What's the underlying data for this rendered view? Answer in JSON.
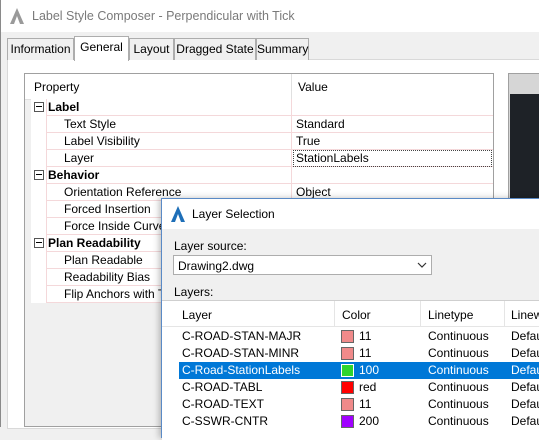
{
  "window": {
    "title": "Label Style Composer - Perpendicular with Tick"
  },
  "tabs": [
    {
      "label": "Information"
    },
    {
      "label": "General"
    },
    {
      "label": "Layout"
    },
    {
      "label": "Dragged State"
    },
    {
      "label": "Summary"
    }
  ],
  "grid": {
    "col_property": "Property",
    "col_value": "Value",
    "rows": [
      {
        "label": "Label",
        "value": ""
      },
      {
        "label": "Text Style",
        "value": "Standard"
      },
      {
        "label": "Label Visibility",
        "value": "True"
      },
      {
        "label": "Layer",
        "value": "StationLabels"
      },
      {
        "label": "Behavior",
        "value": ""
      },
      {
        "label": "Orientation Reference",
        "value": "Object"
      },
      {
        "label": "Forced Insertion",
        "value": ""
      },
      {
        "label": "Force Inside Curve",
        "value": ""
      },
      {
        "label": "Plan Readability",
        "value": ""
      },
      {
        "label": "Plan Readable",
        "value": ""
      },
      {
        "label": "Readability Bias",
        "value": ""
      },
      {
        "label": "Flip Anchors with Tex",
        "value": ""
      }
    ]
  },
  "dialog": {
    "title": "Layer Selection",
    "source_label": "Layer source:",
    "source_value": "Drawing2.dwg",
    "layers_label": "Layers:",
    "columns": {
      "layer": "Layer",
      "color": "Color",
      "linetype": "Linetype",
      "lineweight": "Linew"
    },
    "layers": [
      {
        "name": "C-ROAD-STAN-MAJR",
        "color": "11",
        "swatch": "#f08a8a",
        "linetype": "Continuous",
        "lineweight": "Defau"
      },
      {
        "name": "C-ROAD-STAN-MINR",
        "color": "11",
        "swatch": "#f08a8a",
        "linetype": "Continuous",
        "lineweight": "Defau"
      },
      {
        "name": "C-Road-StationLabels",
        "color": "100",
        "swatch": "#2ed42e",
        "linetype": "Continuous",
        "lineweight": "Defau"
      },
      {
        "name": "C-ROAD-TABL",
        "color": "red",
        "swatch": "#ff0000",
        "linetype": "Continuous",
        "lineweight": "Defau"
      },
      {
        "name": "C-ROAD-TEXT",
        "color": "11",
        "swatch": "#f08a8a",
        "linetype": "Continuous",
        "lineweight": "Defau"
      },
      {
        "name": "C-SSWR-CNTR",
        "color": "200",
        "swatch": "#a000ff",
        "linetype": "Continuous",
        "lineweight": "Defau"
      }
    ]
  },
  "colors": {
    "selection": "#0078d7",
    "dialog_border": "#5a8ac6"
  }
}
